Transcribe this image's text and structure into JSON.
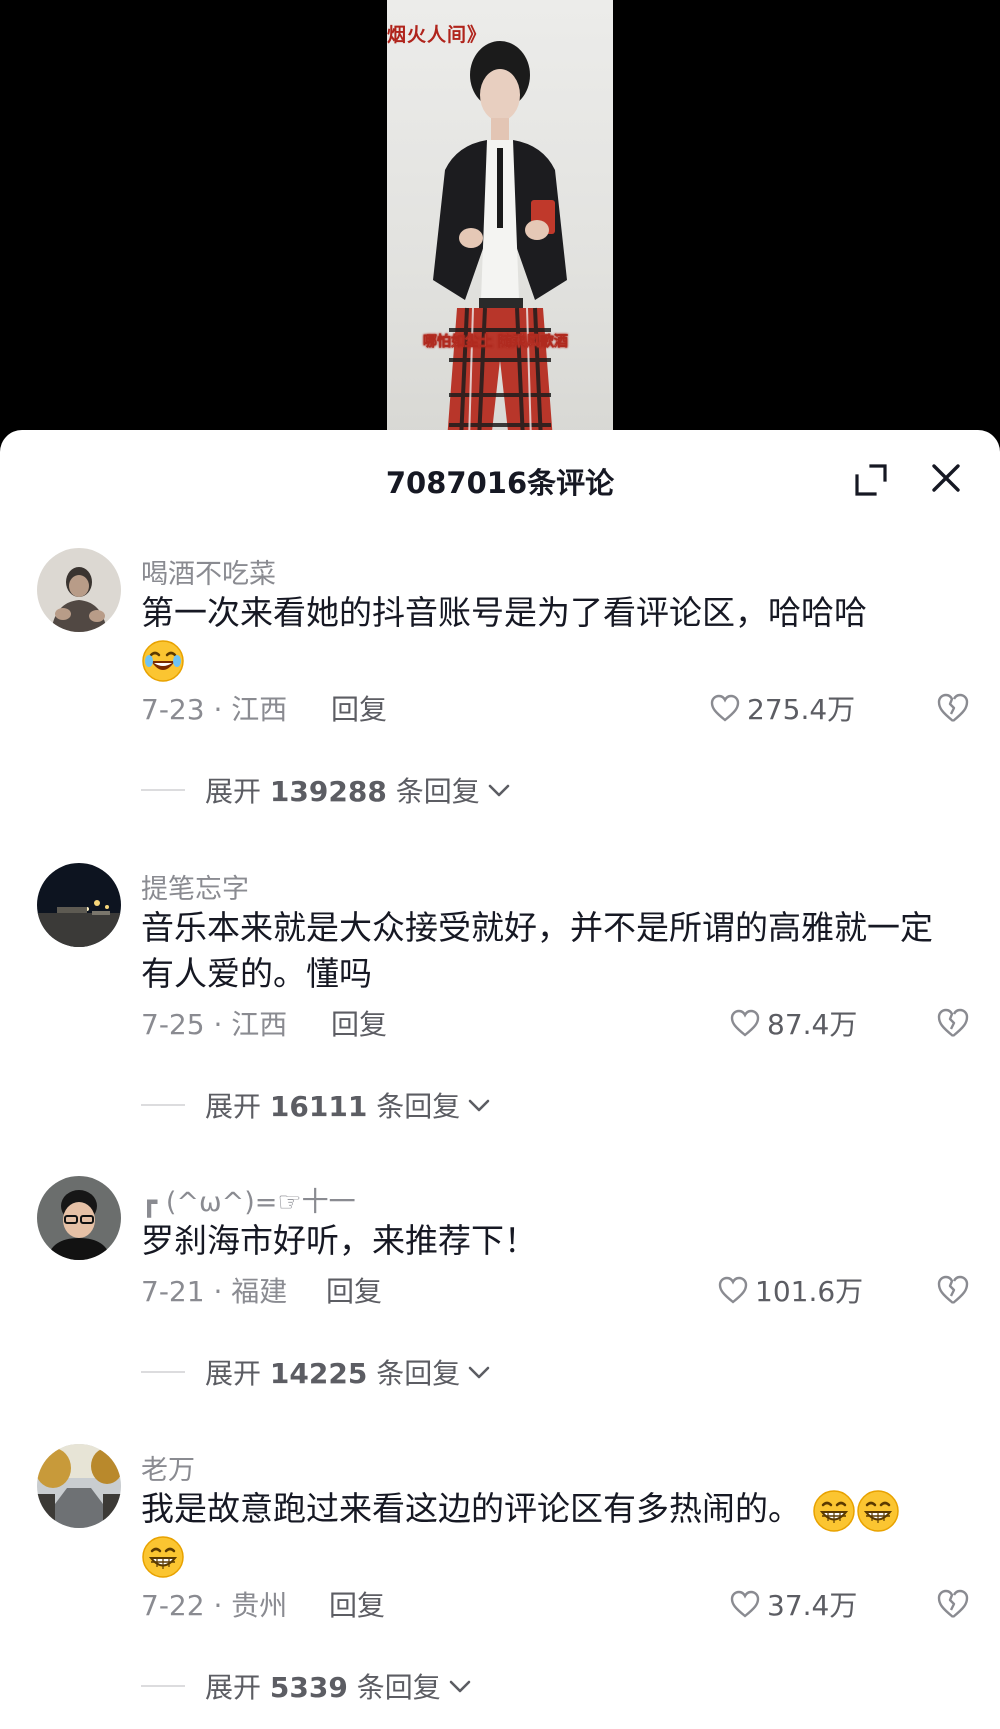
{
  "video": {
    "title": "烟火人间》",
    "subtitle": "哪怕如尘土 随乘风歌酒"
  },
  "panel": {
    "comment_count": "7087016条评论"
  },
  "comments": [
    {
      "username": "喝酒不吃菜",
      "text": "第一次来看她的抖音账号是为了看评论区，哈哈哈",
      "emoji": [
        "rofl-emoji"
      ],
      "date": "7-23 · 江西",
      "reply": "回复",
      "likes": "275.4万",
      "expand_prefix": "展开",
      "expand_count": "139288",
      "expand_suffix": "条回复"
    },
    {
      "username": "提笔忘字",
      "text": "音乐本来就是大众接受就好，并不是所谓的高雅就一定有人爱的。懂吗",
      "emoji": [],
      "date": "7-25 · 江西",
      "reply": "回复",
      "likes": "87.4万",
      "expand_prefix": "展开",
      "expand_count": "16111",
      "expand_suffix": "条回复"
    },
    {
      "username": "┏ (^ω^)=☞十一",
      "text": "罗刹海市好听，来推荐下！",
      "emoji": [],
      "date": "7-21 · 福建",
      "reply": "回复",
      "likes": "101.6万",
      "expand_prefix": "展开",
      "expand_count": "14225",
      "expand_suffix": "条回复"
    },
    {
      "username": "老万",
      "text": "我是故意跑过来看这边的评论区有多热闹的。",
      "emoji": [
        "grin-emoji",
        "grin-emoji",
        "grin-emoji"
      ],
      "date": "7-22 · 贵州",
      "reply": "回复",
      "likes": "37.4万",
      "expand_prefix": "展开",
      "expand_count": "5339",
      "expand_suffix": "条回复"
    }
  ],
  "colors": {
    "text_primary": "#161823",
    "text_secondary": "#8a8b91",
    "accent_red": "#b0241c"
  }
}
